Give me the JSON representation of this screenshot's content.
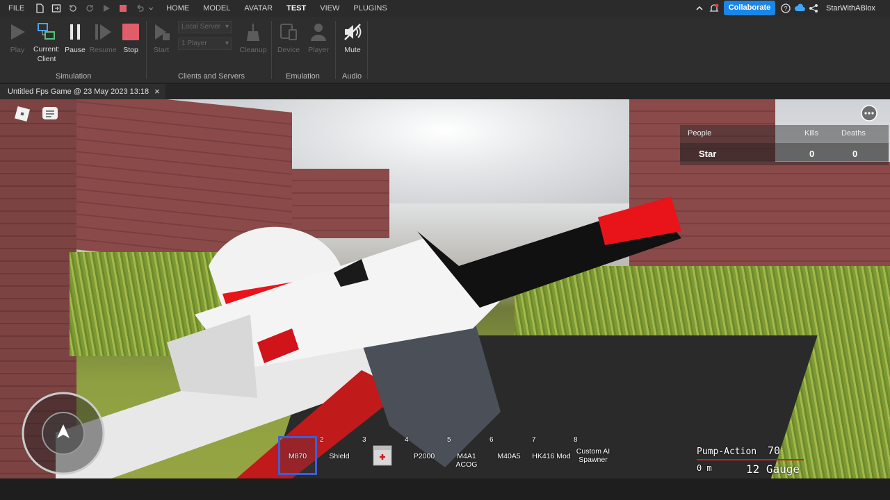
{
  "menubar": {
    "file": "FILE",
    "tabs": [
      "HOME",
      "MODEL",
      "AVATAR",
      "TEST",
      "VIEW",
      "PLUGINS"
    ],
    "active_tab": "TEST",
    "collaborate": "Collaborate",
    "username": "StarWithABlox"
  },
  "ribbon": {
    "simulation": {
      "play": "Play",
      "current_client": "Current:\nClient",
      "pause": "Pause",
      "resume": "Resume",
      "stop": "Stop",
      "group": "Simulation"
    },
    "clients": {
      "start": "Start",
      "server_select": "Local Server",
      "players_select": "1 Player",
      "cleanup": "Cleanup",
      "group": "Clients and Servers"
    },
    "emulation": {
      "device": "Device",
      "player": "Player",
      "group": "Emulation"
    },
    "audio": {
      "mute": "Mute",
      "group": "Audio"
    }
  },
  "doc_tab": {
    "title": "Untitled Fps Game @ 23 May 2023 13:18",
    "close": "×"
  },
  "leaderboard": {
    "headers": [
      "People",
      "Kills",
      "Deaths"
    ],
    "rows": [
      {
        "name": "Star",
        "kills": "0",
        "deaths": "0"
      }
    ]
  },
  "hotbar": [
    {
      "num": "",
      "label": "M870",
      "selected": true
    },
    {
      "num": "2",
      "label": "Shield"
    },
    {
      "num": "3",
      "label": ""
    },
    {
      "num": "4",
      "label": "P2000"
    },
    {
      "num": "5",
      "label": "M4A1 ACOG"
    },
    {
      "num": "6",
      "label": "M40A5"
    },
    {
      "num": "7",
      "label": "HK416 Mod"
    },
    {
      "num": "8",
      "label": "Custom AI Spawner"
    }
  ],
  "weapon_hud": {
    "fire_mode": "Pump-Action",
    "ammo": "70",
    "range": "0 m",
    "caliber": "12 Gauge"
  },
  "colors": {
    "accent": "#1a86e8",
    "stop_red": "#e05e6a",
    "hotbar_select": "#3d5fd6",
    "gun_red": "#e8141a"
  }
}
